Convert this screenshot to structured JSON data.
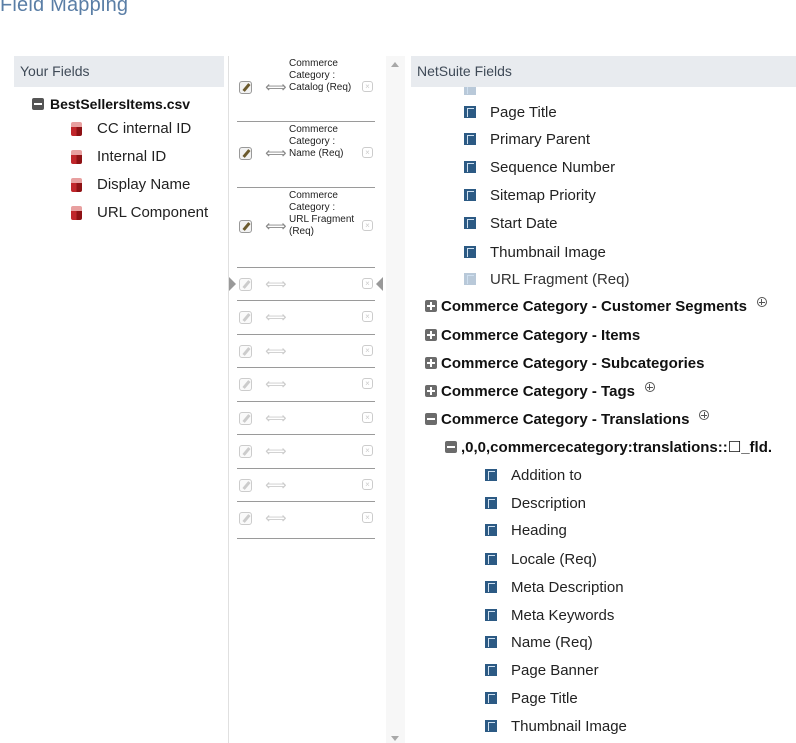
{
  "page": {
    "title": "Field Mapping"
  },
  "your_fields": {
    "header": "Your Fields",
    "file_name": "BestSellersItems.csv",
    "fields": [
      "CC internal ID",
      "Internal ID",
      "Display Name",
      "URL Component"
    ]
  },
  "mapping": {
    "rows": [
      {
        "dest": "Commerce Category : Catalog (Req)"
      },
      {
        "dest": "Commerce Category : Name (Req)"
      },
      {
        "dest": "Commerce Category : URL Fragment (Req)"
      },
      {
        "dest": ""
      },
      {
        "dest": ""
      },
      {
        "dest": ""
      },
      {
        "dest": ""
      },
      {
        "dest": ""
      },
      {
        "dest": ""
      },
      {
        "dest": ""
      },
      {
        "dest": ""
      }
    ],
    "arrow_glyph": "⟺",
    "remove_glyph": "×"
  },
  "netsuite_fields": {
    "header": "NetSuite Fields",
    "category_fields": [
      "Page Title",
      "Primary Parent",
      "Sequence Number",
      "Sitemap Priority",
      "Start Date",
      "Thumbnail Image",
      "URL Fragment (Req)"
    ],
    "groups": [
      {
        "label": "Commerce Category - Customer Segments",
        "expanded": false,
        "has_add": true
      },
      {
        "label": "Commerce Category - Items",
        "expanded": false,
        "has_add": false
      },
      {
        "label": "Commerce Category - Subcategories",
        "expanded": false,
        "has_add": false
      },
      {
        "label": "Commerce Category - Tags",
        "expanded": false,
        "has_add": true
      },
      {
        "label": "Commerce Category - Translations",
        "expanded": true,
        "has_add": true
      }
    ],
    "subgroup_label": ",0,0,commercecategory:translations::☐_fld.",
    "translation_fields": [
      "Addition to",
      "Description",
      "Heading",
      "Locale (Req)",
      "Meta Description",
      "Meta Keywords",
      "Name (Req)",
      "Page Banner",
      "Page Title",
      "Thumbnail Image"
    ]
  },
  "colors": {
    "title": "#5a7ea6",
    "header_bg": "#e8ebef",
    "field_icon": "#2c5a84"
  }
}
